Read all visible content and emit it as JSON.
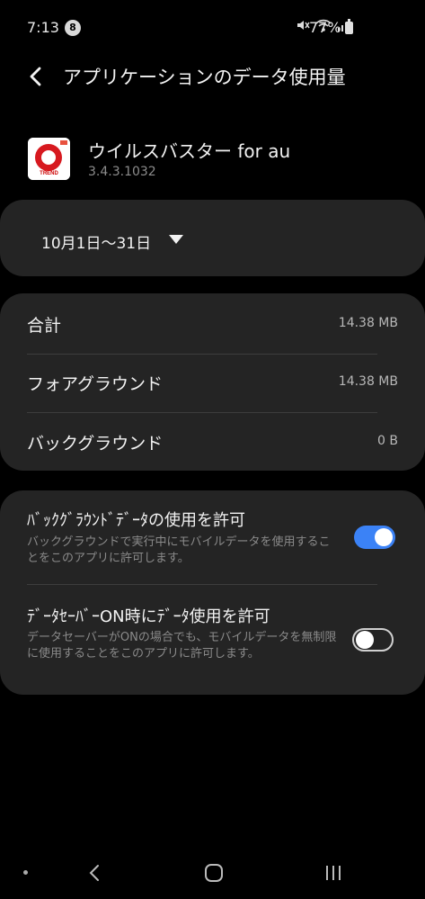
{
  "status_bar": {
    "time": "7:13",
    "notification_count": "8",
    "battery": "77%"
  },
  "header": {
    "title": "アプリケーションのデータ使用量"
  },
  "app": {
    "name": "ウイルスバスター for au",
    "version": "3.4.3.1032",
    "icon_text": "TREND"
  },
  "date_range": {
    "label": "10月1日〜31日"
  },
  "usage": {
    "rows": [
      {
        "label": "合計",
        "value": "14.38 MB"
      },
      {
        "label": "フォアグラウンド",
        "value": "14.38 MB"
      },
      {
        "label": "バックグラウンド",
        "value": "0 B"
      }
    ]
  },
  "settings": {
    "background_data": {
      "title": "ﾊﾞｯｸｸﾞﾗｳﾝﾄﾞﾃﾞｰﾀの使用を許可",
      "desc": "バックグラウンドで実行中にモバイルデータを使用することをこのアプリに許可します。",
      "enabled": true
    },
    "data_saver": {
      "title": "ﾃﾞｰﾀｾｰﾊﾞｰON時にﾃﾞｰﾀ使用を許可",
      "desc": "データセーバーがONの場合でも、モバイルデータを無制限に使用することをこのアプリに許可します。",
      "enabled": false
    }
  },
  "colors": {
    "accent": "#3b82f6",
    "card_bg": "#242424",
    "background": "#000000"
  }
}
